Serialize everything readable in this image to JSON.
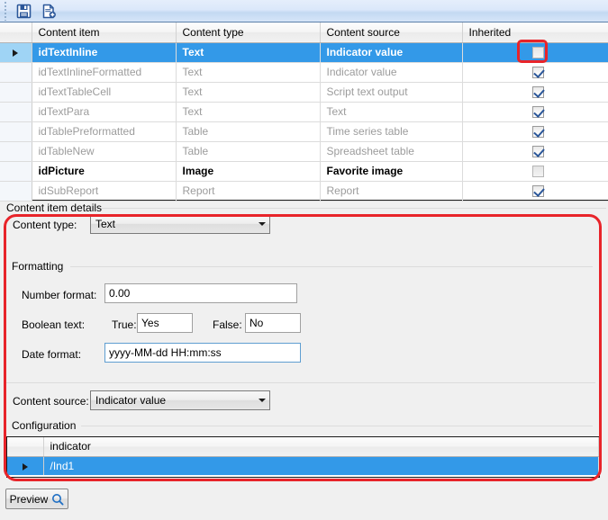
{
  "toolbar": {
    "buttons": [
      {
        "name": "save-icon",
        "title": "Save"
      },
      {
        "name": "new-document-icon",
        "title": "New"
      }
    ]
  },
  "content_grid": {
    "columns": [
      "Content item",
      "Content type",
      "Content source",
      "Inherited"
    ],
    "rows": [
      {
        "item": "idTextInline",
        "type": "Text",
        "source": "Indicator value",
        "inherited": false,
        "selected": true,
        "emphasis": "selected"
      },
      {
        "item": "idTextInlineFormatted",
        "type": "Text",
        "source": "Indicator value",
        "inherited": true,
        "selected": false,
        "emphasis": "muted"
      },
      {
        "item": "idTextTableCell",
        "type": "Text",
        "source": "Script text output",
        "inherited": true,
        "selected": false,
        "emphasis": "muted"
      },
      {
        "item": "idTextPara",
        "type": "Text",
        "source": "Text",
        "inherited": true,
        "selected": false,
        "emphasis": "muted"
      },
      {
        "item": "idTablePreformatted",
        "type": "Table",
        "source": "Time series table",
        "inherited": true,
        "selected": false,
        "emphasis": "muted"
      },
      {
        "item": "idTableNew",
        "type": "Table",
        "source": "Spreadsheet table",
        "inherited": true,
        "selected": false,
        "emphasis": "muted"
      },
      {
        "item": "idPicture",
        "type": "Image",
        "source": "Favorite image",
        "inherited": false,
        "selected": false,
        "emphasis": "strong"
      },
      {
        "item": "idSubReport",
        "type": "Report",
        "source": "Report",
        "inherited": true,
        "selected": false,
        "emphasis": "muted"
      }
    ]
  },
  "details": {
    "group_title": "Content item details",
    "content_type_label": "Content type:",
    "content_type_value": "Text",
    "formatting_group": "Formatting",
    "number_format_label": "Number format:",
    "number_format_value": "0.00",
    "boolean_text_label": "Boolean text:",
    "true_label": "True:",
    "true_value": "Yes",
    "false_label": "False:",
    "false_value": "No",
    "date_format_label": "Date format:",
    "date_format_value": "yyyy-MM-dd HH:mm:ss",
    "content_source_label": "Content source:",
    "content_source_value": "Indicator value",
    "configuration_group": "Configuration"
  },
  "config_grid": {
    "columns": [
      "indicator"
    ],
    "rows": [
      {
        "indicator": "/Ind1",
        "selected": true
      }
    ]
  },
  "preview": {
    "label": "Preview",
    "icon": "magnifier-icon"
  },
  "colors": {
    "selection_blue": "#3399e8",
    "selection_row_header": "#9fd4f5",
    "annotation_red": "#e8242a",
    "muted_text": "#9c9c9c",
    "focus_border": "#5f9ed1"
  }
}
